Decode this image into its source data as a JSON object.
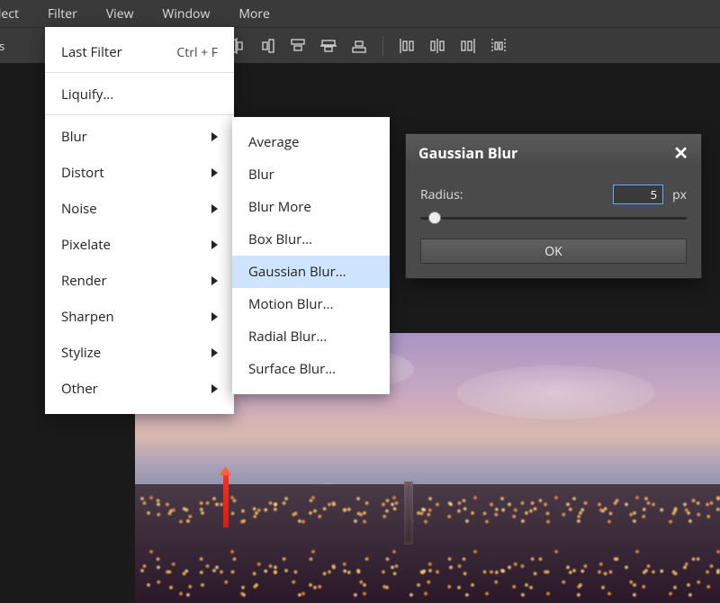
{
  "menubar": [
    "elect",
    "Filter",
    "View",
    "Window",
    "More"
  ],
  "toolbar_label": "trols",
  "filter_menu": {
    "last_filter": {
      "label": "Last Filter",
      "shortcut": "Ctrl + F"
    },
    "liquify": "Liquify...",
    "items": [
      "Blur",
      "Distort",
      "Noise",
      "Pixelate",
      "Render",
      "Sharpen",
      "Stylize",
      "Other"
    ]
  },
  "blur_submenu": {
    "items": [
      "Average",
      "Blur",
      "Blur More",
      "Box Blur...",
      "Gaussian Blur...",
      "Motion Blur...",
      "Radial Blur...",
      "Surface Blur..."
    ],
    "highlighted_index": 4
  },
  "dialog": {
    "title": "Gaussian Blur",
    "radius_label": "Radius:",
    "radius_value": "5",
    "radius_unit": "px",
    "ok": "OK"
  }
}
